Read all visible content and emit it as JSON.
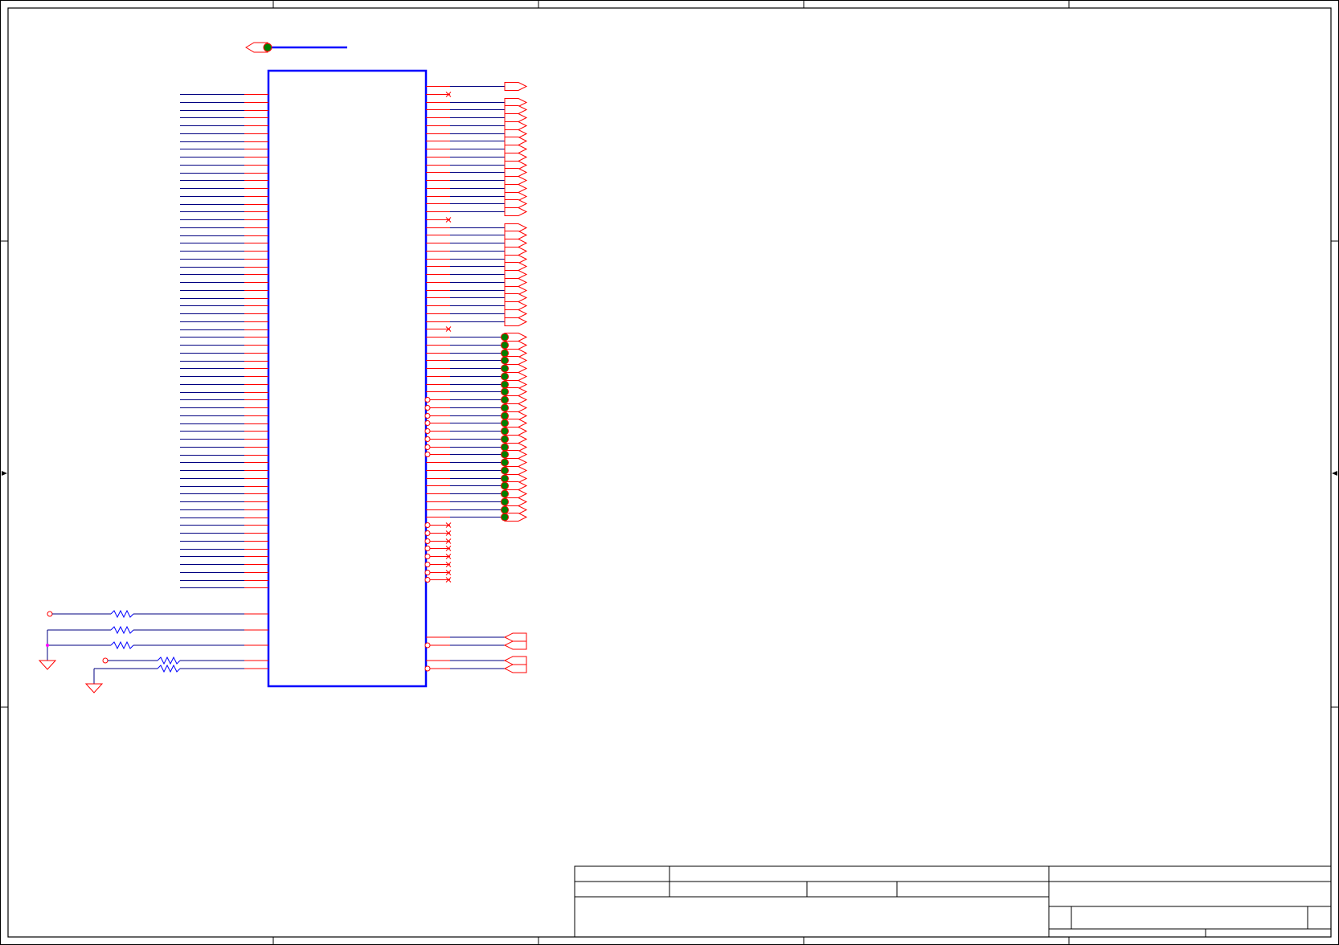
{
  "document": {
    "type": "schematic-sheet",
    "title_block": {
      "cells_text": [
        "",
        "",
        "",
        "",
        "",
        "",
        "",
        "",
        ""
      ]
    }
  },
  "colors": {
    "frame": "#000000",
    "component": "#0000ff",
    "wire": "#000080",
    "pin": "#ff0000",
    "junction": "#008000",
    "background": "#ffffff"
  },
  "chip": {
    "left_pin_count": 64,
    "right_groups": [
      {
        "kind": "port-output",
        "count": 1
      },
      {
        "kind": "no-connect",
        "count": 1
      },
      {
        "kind": "port-output",
        "count": 15
      },
      {
        "kind": "no-connect",
        "count": 1
      },
      {
        "kind": "port-output",
        "count": 13
      },
      {
        "kind": "no-connect",
        "count": 1
      },
      {
        "kind": "port-output-tested",
        "count": 8
      },
      {
        "kind": "port-output-tested-inverted",
        "count": 8
      },
      {
        "kind": "port-output-tested",
        "count": 8
      },
      {
        "kind": "no-connect-inverted",
        "count": 8
      },
      {
        "kind": "diff-pair-port",
        "count": 2
      }
    ]
  },
  "passives": {
    "resistor_count": 5,
    "ground_symbol_count": 2,
    "test_point_count": 2
  },
  "icons": [
    "ground-icon",
    "resistor-icon",
    "port-icon",
    "test-point-icon",
    "no-connect-icon"
  ]
}
